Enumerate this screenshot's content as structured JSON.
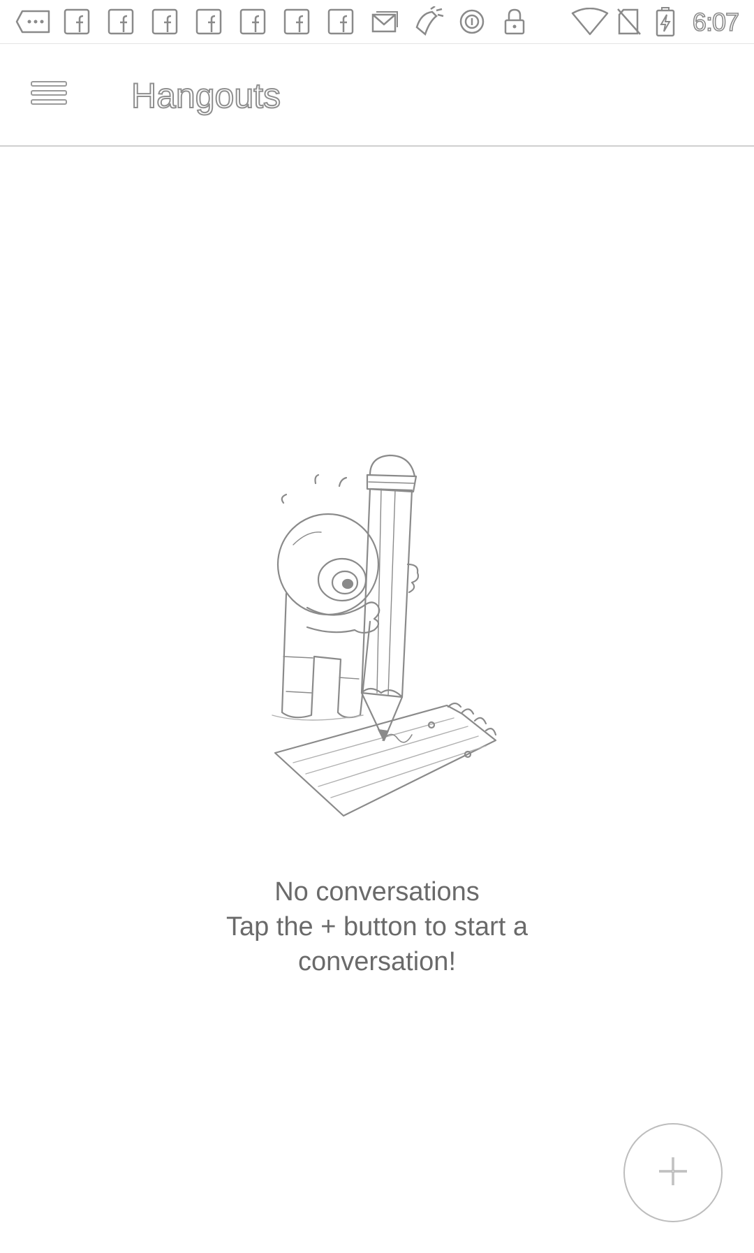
{
  "status_bar": {
    "time": "6:07",
    "icons": [
      "messages-more-icon",
      "facebook-icon",
      "facebook-icon",
      "facebook-icon",
      "facebook-icon",
      "facebook-icon",
      "facebook-icon",
      "facebook-icon",
      "email-icon",
      "app-notification-icon",
      "data-saver-icon",
      "lock-icon",
      "wifi-icon",
      "no-sim-icon",
      "battery-charging-icon"
    ]
  },
  "app_bar": {
    "title": "Hangouts",
    "menu_icon": "hamburger-menu-icon"
  },
  "empty_state": {
    "illustration_icon": "pencil-character-illustration",
    "title": "No conversations",
    "line1": "Tap the + button to start a",
    "line2": "conversation!"
  },
  "fab": {
    "icon": "plus-icon"
  },
  "colors": {
    "background": "#ffffff",
    "icon_stroke": "#8a8a8a",
    "text": "#6a6a6a",
    "divider": "#cfcfcf"
  }
}
